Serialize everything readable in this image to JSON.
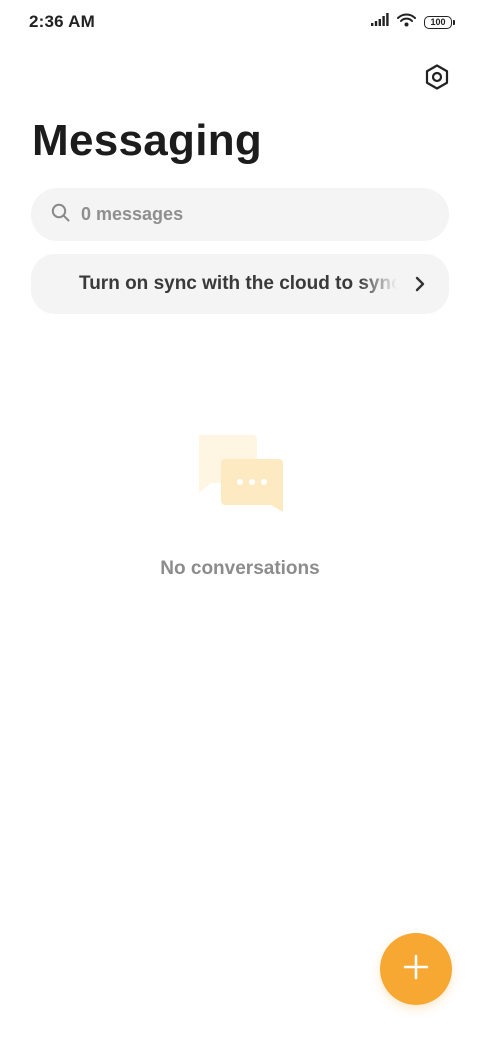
{
  "status_bar": {
    "time": "2:36 AM",
    "battery_level": "100",
    "icons": [
      "signal-icon",
      "wifi-icon",
      "battery-icon"
    ]
  },
  "header": {
    "title": "Messaging",
    "settings_icon": "settings-hexagon-icon"
  },
  "search": {
    "placeholder": "0 messages",
    "icon": "search-icon"
  },
  "sync_banner": {
    "text": "Turn on sync with the cloud to sync messages",
    "icon": "chevron-right-icon"
  },
  "empty_state": {
    "icon": "chat-bubbles-icon",
    "text": "No conversations"
  },
  "fab": {
    "icon": "plus-icon",
    "color": "#F7A833"
  },
  "colors": {
    "accent": "#F7A833",
    "surface": "#F4F4F4",
    "illustration_back": "#FEF6E3",
    "illustration_front": "#FDEAC2"
  }
}
